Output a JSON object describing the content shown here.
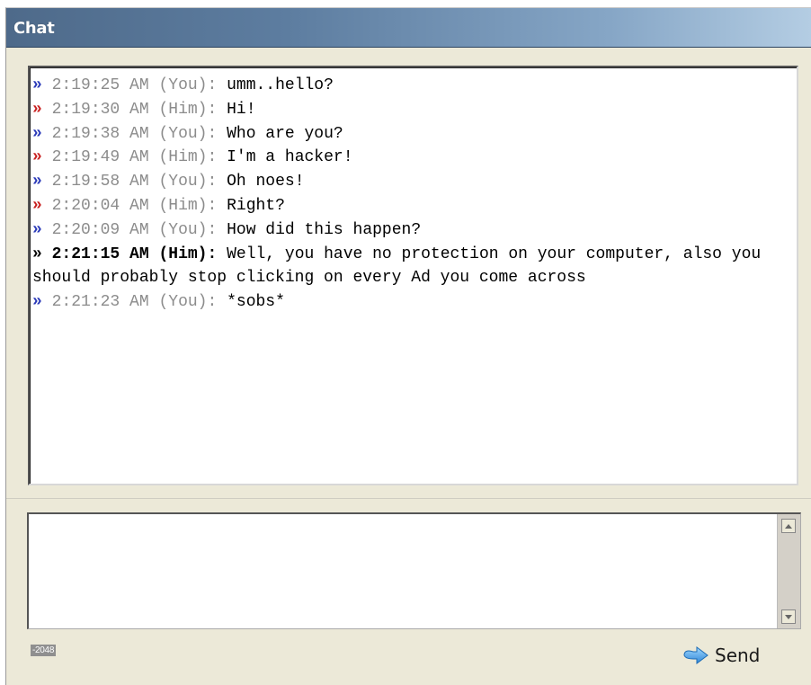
{
  "window": {
    "title": "Chat"
  },
  "messages": [
    {
      "time": "2:19:25 AM",
      "sender": "(You):",
      "who": "you",
      "text": "umm..hello?"
    },
    {
      "time": "2:19:30 AM",
      "sender": "(Him):",
      "who": "him",
      "text": "Hi!"
    },
    {
      "time": "2:19:38 AM",
      "sender": "(You):",
      "who": "you",
      "text": "Who are you?"
    },
    {
      "time": "2:19:49 AM",
      "sender": "(Him):",
      "who": "him",
      "text": "I'm a hacker!"
    },
    {
      "time": "2:19:58 AM",
      "sender": "(You):",
      "who": "you",
      "text": "Oh noes!"
    },
    {
      "time": "2:20:04 AM",
      "sender": "(Him):",
      "who": "him",
      "text": "Right?"
    },
    {
      "time": "2:20:09 AM",
      "sender": "(You):",
      "who": "you",
      "text": "How did this happen?"
    },
    {
      "time": "2:21:15 AM",
      "sender": "(Him):",
      "who": "him",
      "bold": true,
      "text": "Well, you have no protection on your computer, also you should probably stop clicking on every Ad you come across"
    },
    {
      "time": "2:21:23 AM",
      "sender": "(You):",
      "who": "you",
      "text": "*sobs*"
    }
  ],
  "marker_glyph": "»",
  "input": {
    "value": "",
    "char_limit": "-2048"
  },
  "send_button": {
    "label": "Send",
    "icon": "send-arrow-icon"
  },
  "colors": {
    "you_marker": "#2a39b8",
    "him_marker": "#c81f1f",
    "meta_text": "#8c8c8c"
  }
}
